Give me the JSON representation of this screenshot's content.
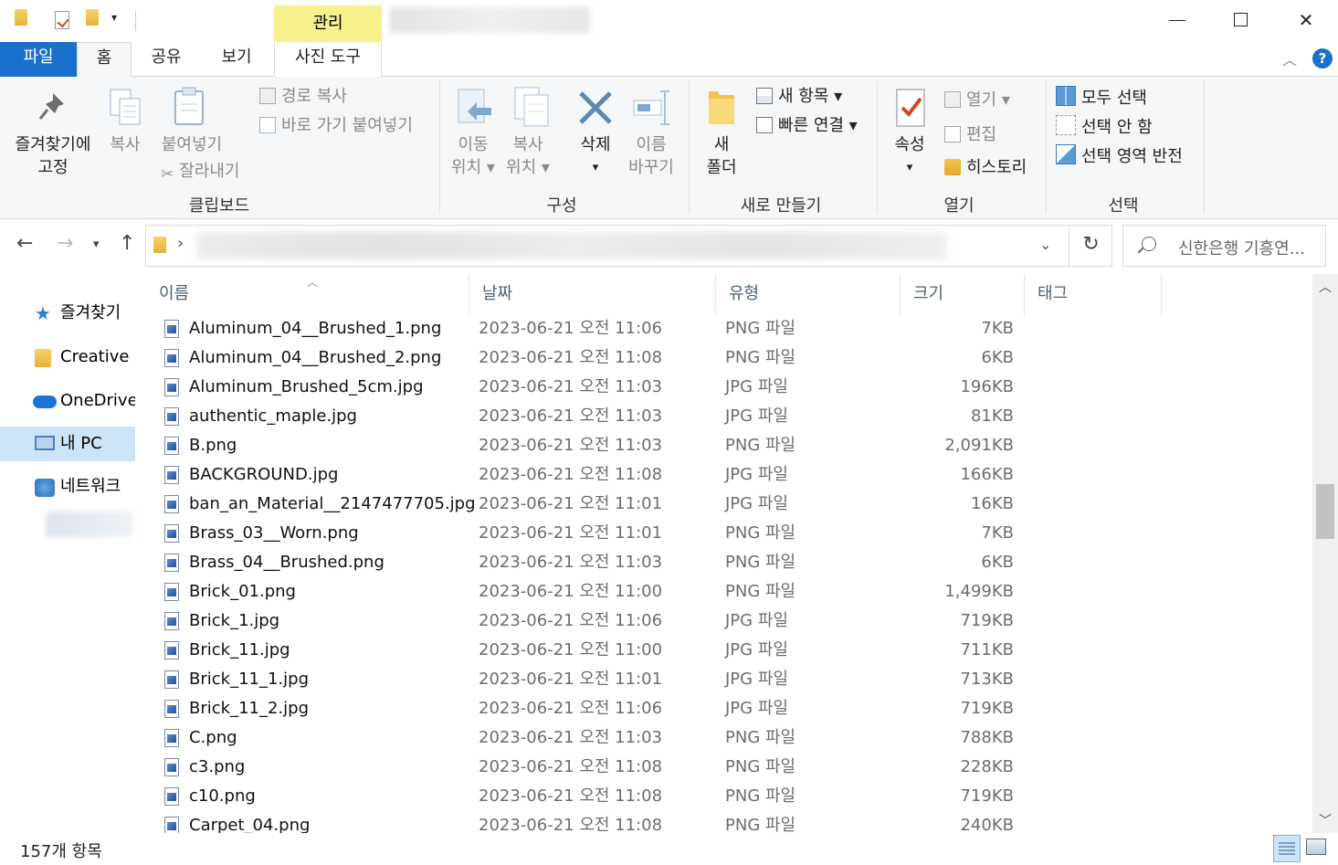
{
  "ribbon_tabs": {
    "file": "파일",
    "home": "홈",
    "share": "공유",
    "view": "보기",
    "manage": "관리",
    "photo_tools": "사진 도구"
  },
  "clipboard": {
    "pin_line1": "즐겨찾기에",
    "pin_line2": "고정",
    "copy": "복사",
    "paste": "붙여넣기",
    "copy_path": "경로 복사",
    "paste_shortcut": "바로 가기 붙여넣기",
    "cut": "잘라내기",
    "label": "클립보드"
  },
  "organize": {
    "move_line1": "이동",
    "move_line2": "위치 ▾",
    "copy_line1": "복사",
    "copy_line2": "위치 ▾",
    "delete": "삭제",
    "delete_arrow": "▾",
    "rename_line1": "이름",
    "rename_line2": "바꾸기",
    "label": "구성"
  },
  "new": {
    "folder_line1": "새",
    "folder_line2": "폴더",
    "new_item": "새 항목 ▾",
    "easy_access": "빠른 연결 ▾",
    "label": "새로 만들기"
  },
  "open": {
    "properties": "속성",
    "properties_arrow": "▾",
    "open": "열기 ▾",
    "edit": "편집",
    "history": "히스토리",
    "label": "열기"
  },
  "select": {
    "select_all": "모두 선택",
    "select_none": "선택 안 함",
    "invert": "선택 영역 반전",
    "label": "선택"
  },
  "search": {
    "placeholder": "신한은행 기흥연..."
  },
  "nav": [
    {
      "label": "즐겨찾기"
    },
    {
      "label": "Creative Cloud Files"
    },
    {
      "label": "OneDrive"
    },
    {
      "label": "내 PC"
    },
    {
      "label": "네트워크"
    }
  ],
  "columns": {
    "name": "이름",
    "date": "날짜",
    "type": "유형",
    "size": "크기",
    "tags": "태그"
  },
  "files": [
    {
      "name": "Aluminum_04__Brushed_1.png",
      "date": "2023-06-21 오전 11:06",
      "type": "PNG 파일",
      "size": "7KB"
    },
    {
      "name": "Aluminum_04__Brushed_2.png",
      "date": "2023-06-21 오전 11:08",
      "type": "PNG 파일",
      "size": "6KB"
    },
    {
      "name": "Aluminum_Brushed_5cm.jpg",
      "date": "2023-06-21 오전 11:03",
      "type": "JPG 파일",
      "size": "196KB"
    },
    {
      "name": "authentic_maple.jpg",
      "date": "2023-06-21 오전 11:03",
      "type": "JPG 파일",
      "size": "81KB"
    },
    {
      "name": "B.png",
      "date": "2023-06-21 오전 11:03",
      "type": "PNG 파일",
      "size": "2,091KB"
    },
    {
      "name": "BACKGROUND.jpg",
      "date": "2023-06-21 오전 11:08",
      "type": "JPG 파일",
      "size": "166KB"
    },
    {
      "name": "ban_an_Material__2147477705.jpg",
      "date": "2023-06-21 오전 11:01",
      "type": "JPG 파일",
      "size": "16KB"
    },
    {
      "name": "Brass_03__Worn.png",
      "date": "2023-06-21 오전 11:01",
      "type": "PNG 파일",
      "size": "7KB"
    },
    {
      "name": "Brass_04__Brushed.png",
      "date": "2023-06-21 오전 11:03",
      "type": "PNG 파일",
      "size": "6KB"
    },
    {
      "name": "Brick_01.png",
      "date": "2023-06-21 오전 11:00",
      "type": "PNG 파일",
      "size": "1,499KB"
    },
    {
      "name": "Brick_1.jpg",
      "date": "2023-06-21 오전 11:06",
      "type": "JPG 파일",
      "size": "719KB"
    },
    {
      "name": "Brick_11.jpg",
      "date": "2023-06-21 오전 11:00",
      "type": "JPG 파일",
      "size": "711KB"
    },
    {
      "name": "Brick_11_1.jpg",
      "date": "2023-06-21 오전 11:01",
      "type": "JPG 파일",
      "size": "713KB"
    },
    {
      "name": "Brick_11_2.jpg",
      "date": "2023-06-21 오전 11:06",
      "type": "JPG 파일",
      "size": "719KB"
    },
    {
      "name": "C.png",
      "date": "2023-06-21 오전 11:03",
      "type": "PNG 파일",
      "size": "788KB"
    },
    {
      "name": "c3.png",
      "date": "2023-06-21 오전 11:08",
      "type": "PNG 파일",
      "size": "228KB"
    },
    {
      "name": "c10.png",
      "date": "2023-06-21 오전 11:08",
      "type": "PNG 파일",
      "size": "719KB"
    },
    {
      "name": "Carpet_04.png",
      "date": "2023-06-21 오전 11:08",
      "type": "PNG 파일",
      "size": "240KB"
    }
  ],
  "status": {
    "item_count": "157개 항목"
  },
  "colors": {
    "accent": "#1a6ecc",
    "manage_tab": "#f5f18b",
    "selected_nav": "#cce4f7"
  }
}
